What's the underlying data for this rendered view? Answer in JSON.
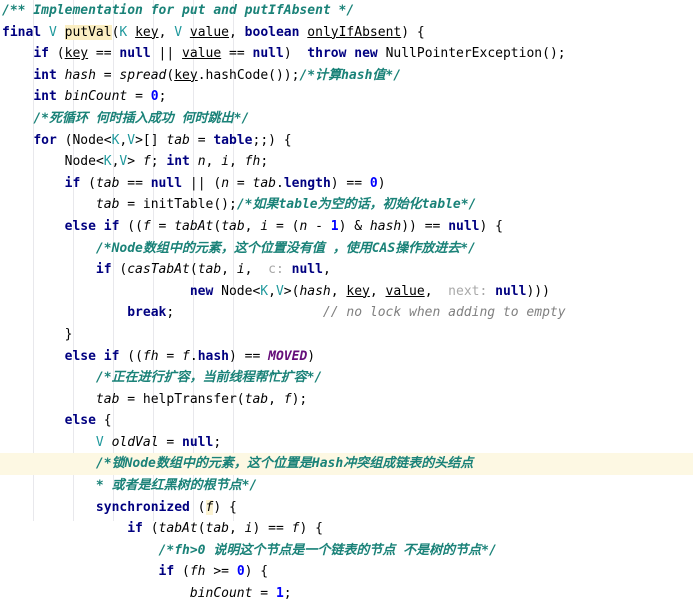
{
  "editor": {
    "language": "Java",
    "theme": "IntelliJ Light",
    "colors": {
      "background": "#ffffff",
      "keyword": "#000080",
      "comment": "#1a8278",
      "line_comment": "#808080",
      "type_param": "#20999d",
      "number": "#0000ff",
      "static_final_field": "#660e7a",
      "inlay_hint": "#a8a8a8",
      "caret_row": "#fdf8e3",
      "usage_highlight": "#fbeec2",
      "indent_guide": "#e8e8ec"
    },
    "caret_line_index": 21,
    "indent_guide_x": [
      33,
      73,
      113,
      153,
      193,
      233
    ]
  },
  "code_lines": [
    {
      "indent": 0,
      "tokens": [
        {
          "t": "/** Implementation for put and putIfAbsent */",
          "c": "cmt"
        }
      ]
    },
    {
      "indent": 0,
      "tokens": [
        {
          "t": "final",
          "c": "kw"
        },
        {
          "t": " ",
          "c": "plain"
        },
        {
          "t": "V",
          "c": "typ"
        },
        {
          "t": " ",
          "c": "plain"
        },
        {
          "t": "putVal",
          "c": "mth mark"
        },
        {
          "t": "(",
          "c": "plain"
        },
        {
          "t": "K",
          "c": "typ"
        },
        {
          "t": " ",
          "c": "plain"
        },
        {
          "t": "key",
          "c": "prm"
        },
        {
          "t": ", ",
          "c": "plain"
        },
        {
          "t": "V",
          "c": "typ"
        },
        {
          "t": " ",
          "c": "plain"
        },
        {
          "t": "value",
          "c": "prm"
        },
        {
          "t": ", ",
          "c": "plain"
        },
        {
          "t": "boolean",
          "c": "kw"
        },
        {
          "t": " ",
          "c": "plain"
        },
        {
          "t": "onlyIfAbsent",
          "c": "prm"
        },
        {
          "t": ") {",
          "c": "plain"
        }
      ]
    },
    {
      "indent": 1,
      "tokens": [
        {
          "t": "if",
          "c": "kw"
        },
        {
          "t": " (",
          "c": "plain"
        },
        {
          "t": "key",
          "c": "prm"
        },
        {
          "t": " == ",
          "c": "plain"
        },
        {
          "t": "null",
          "c": "kw"
        },
        {
          "t": " || ",
          "c": "plain"
        },
        {
          "t": "value",
          "c": "prm"
        },
        {
          "t": " == ",
          "c": "plain"
        },
        {
          "t": "null",
          "c": "kw"
        },
        {
          "t": ")  ",
          "c": "plain"
        },
        {
          "t": "throw",
          "c": "kw"
        },
        {
          "t": " ",
          "c": "plain"
        },
        {
          "t": "new",
          "c": "kw"
        },
        {
          "t": " ",
          "c": "plain"
        },
        {
          "t": "NullPointerException",
          "c": "cls"
        },
        {
          "t": "();",
          "c": "plain"
        }
      ]
    },
    {
      "indent": 1,
      "tokens": [
        {
          "t": "int",
          "c": "kw"
        },
        {
          "t": " ",
          "c": "plain"
        },
        {
          "t": "hash",
          "c": "loc"
        },
        {
          "t": " = ",
          "c": "plain"
        },
        {
          "t": "spread",
          "c": "loc"
        },
        {
          "t": "(",
          "c": "plain"
        },
        {
          "t": "key",
          "c": "prm"
        },
        {
          "t": ".hashCode());",
          "c": "plain"
        },
        {
          "t": "/*计算hash值*/",
          "c": "cmt"
        }
      ]
    },
    {
      "indent": 1,
      "tokens": [
        {
          "t": "int",
          "c": "kw"
        },
        {
          "t": " ",
          "c": "plain"
        },
        {
          "t": "binCount",
          "c": "loc"
        },
        {
          "t": " = ",
          "c": "plain"
        },
        {
          "t": "0",
          "c": "num"
        },
        {
          "t": ";",
          "c": "plain"
        }
      ]
    },
    {
      "indent": 1,
      "tokens": [
        {
          "t": "/*死循环 何时插入成功 何时跳出*/",
          "c": "cmt"
        }
      ]
    },
    {
      "indent": 1,
      "tokens": [
        {
          "t": "for",
          "c": "kw"
        },
        {
          "t": " (",
          "c": "plain"
        },
        {
          "t": "Node",
          "c": "cls"
        },
        {
          "t": "<",
          "c": "plain"
        },
        {
          "t": "K",
          "c": "typ"
        },
        {
          "t": ",",
          "c": "plain"
        },
        {
          "t": "V",
          "c": "typ"
        },
        {
          "t": ">[] ",
          "c": "plain"
        },
        {
          "t": "tab",
          "c": "loc"
        },
        {
          "t": " = ",
          "c": "plain"
        },
        {
          "t": "table",
          "c": "kw"
        },
        {
          "t": ";;) {",
          "c": "plain"
        }
      ]
    },
    {
      "indent": 2,
      "tokens": [
        {
          "t": "Node",
          "c": "cls"
        },
        {
          "t": "<",
          "c": "plain"
        },
        {
          "t": "K",
          "c": "typ"
        },
        {
          "t": ",",
          "c": "plain"
        },
        {
          "t": "V",
          "c": "typ"
        },
        {
          "t": "> ",
          "c": "plain"
        },
        {
          "t": "f",
          "c": "loc"
        },
        {
          "t": "; ",
          "c": "plain"
        },
        {
          "t": "int",
          "c": "kw"
        },
        {
          "t": " ",
          "c": "plain"
        },
        {
          "t": "n",
          "c": "loc"
        },
        {
          "t": ", ",
          "c": "plain"
        },
        {
          "t": "i",
          "c": "loc"
        },
        {
          "t": ", ",
          "c": "plain"
        },
        {
          "t": "fh",
          "c": "loc"
        },
        {
          "t": ";",
          "c": "plain"
        }
      ]
    },
    {
      "indent": 2,
      "tokens": [
        {
          "t": "if",
          "c": "kw"
        },
        {
          "t": " (",
          "c": "plain"
        },
        {
          "t": "tab",
          "c": "loc"
        },
        {
          "t": " == ",
          "c": "plain"
        },
        {
          "t": "null",
          "c": "kw"
        },
        {
          "t": " || (",
          "c": "plain"
        },
        {
          "t": "n",
          "c": "loc"
        },
        {
          "t": " = ",
          "c": "plain"
        },
        {
          "t": "tab",
          "c": "loc"
        },
        {
          "t": ".",
          "c": "plain"
        },
        {
          "t": "length",
          "c": "kw"
        },
        {
          "t": ") == ",
          "c": "plain"
        },
        {
          "t": "0",
          "c": "num"
        },
        {
          "t": ")",
          "c": "plain"
        }
      ]
    },
    {
      "indent": 3,
      "tokens": [
        {
          "t": "tab",
          "c": "loc"
        },
        {
          "t": " = initTable();",
          "c": "plain"
        },
        {
          "t": "/*如果table为空的话，初始化table*/",
          "c": "cmt"
        }
      ]
    },
    {
      "indent": 2,
      "tokens": [
        {
          "t": "else",
          "c": "kw"
        },
        {
          "t": " ",
          "c": "plain"
        },
        {
          "t": "if",
          "c": "kw"
        },
        {
          "t": " ((",
          "c": "plain"
        },
        {
          "t": "f",
          "c": "loc"
        },
        {
          "t": " = ",
          "c": "plain"
        },
        {
          "t": "tabAt",
          "c": "loc"
        },
        {
          "t": "(",
          "c": "plain"
        },
        {
          "t": "tab",
          "c": "loc"
        },
        {
          "t": ", ",
          "c": "plain"
        },
        {
          "t": "i",
          "c": "loc"
        },
        {
          "t": " = (",
          "c": "plain"
        },
        {
          "t": "n",
          "c": "loc"
        },
        {
          "t": " - ",
          "c": "plain"
        },
        {
          "t": "1",
          "c": "num"
        },
        {
          "t": ") & ",
          "c": "plain"
        },
        {
          "t": "hash",
          "c": "loc"
        },
        {
          "t": ")) == ",
          "c": "plain"
        },
        {
          "t": "null",
          "c": "kw"
        },
        {
          "t": ") {",
          "c": "plain"
        }
      ]
    },
    {
      "indent": 3,
      "tokens": [
        {
          "t": "/*Node数组中的元素，这个位置没有值 ，使用CAS操作放进去*/",
          "c": "cmt"
        }
      ]
    },
    {
      "indent": 3,
      "tokens": [
        {
          "t": "if",
          "c": "kw"
        },
        {
          "t": " (",
          "c": "plain"
        },
        {
          "t": "casTabAt",
          "c": "loc"
        },
        {
          "t": "(",
          "c": "plain"
        },
        {
          "t": "tab",
          "c": "loc"
        },
        {
          "t": ", ",
          "c": "plain"
        },
        {
          "t": "i",
          "c": "loc"
        },
        {
          "t": ",  ",
          "c": "plain"
        },
        {
          "t": "c:",
          "c": "hint"
        },
        {
          "t": " ",
          "c": "plain"
        },
        {
          "t": "null",
          "c": "kw"
        },
        {
          "t": ",",
          "c": "plain"
        }
      ]
    },
    {
      "indent": 6,
      "tokens": [
        {
          "t": "new",
          "c": "kw"
        },
        {
          "t": " ",
          "c": "plain"
        },
        {
          "t": "Node",
          "c": "cls"
        },
        {
          "t": "<",
          "c": "plain"
        },
        {
          "t": "K",
          "c": "typ"
        },
        {
          "t": ",",
          "c": "plain"
        },
        {
          "t": "V",
          "c": "typ"
        },
        {
          "t": ">(",
          "c": "plain"
        },
        {
          "t": "hash",
          "c": "loc"
        },
        {
          "t": ", ",
          "c": "plain"
        },
        {
          "t": "key",
          "c": "prm"
        },
        {
          "t": ", ",
          "c": "plain"
        },
        {
          "t": "value",
          "c": "prm"
        },
        {
          "t": ",  ",
          "c": "plain"
        },
        {
          "t": "next:",
          "c": "hint"
        },
        {
          "t": " ",
          "c": "plain"
        },
        {
          "t": "null",
          "c": "kw"
        },
        {
          "t": ")))",
          "c": "plain"
        }
      ]
    },
    {
      "indent": 4,
      "tokens": [
        {
          "t": "break",
          "c": "kw"
        },
        {
          "t": ";",
          "c": "plain"
        },
        {
          "t": "                   ",
          "c": "plain"
        },
        {
          "t": "// no lock when adding to empty",
          "c": "cmt2"
        }
      ]
    },
    {
      "indent": 2,
      "tokens": [
        {
          "t": "}",
          "c": "plain"
        }
      ]
    },
    {
      "indent": 2,
      "tokens": [
        {
          "t": "else",
          "c": "kw"
        },
        {
          "t": " ",
          "c": "plain"
        },
        {
          "t": "if",
          "c": "kw"
        },
        {
          "t": " ((",
          "c": "plain"
        },
        {
          "t": "fh",
          "c": "loc"
        },
        {
          "t": " = ",
          "c": "plain"
        },
        {
          "t": "f",
          "c": "loc"
        },
        {
          "t": ".",
          "c": "plain"
        },
        {
          "t": "hash",
          "c": "kw"
        },
        {
          "t": ") == ",
          "c": "plain"
        },
        {
          "t": "MOVED",
          "c": "fld"
        },
        {
          "t": ")",
          "c": "plain"
        }
      ]
    },
    {
      "indent": 3,
      "tokens": [
        {
          "t": "/*正在进行扩容，当前线程帮忙扩容*/",
          "c": "cmt"
        }
      ]
    },
    {
      "indent": 3,
      "tokens": [
        {
          "t": "tab",
          "c": "loc"
        },
        {
          "t": " = helpTransfer(",
          "c": "plain"
        },
        {
          "t": "tab",
          "c": "loc"
        },
        {
          "t": ", ",
          "c": "plain"
        },
        {
          "t": "f",
          "c": "loc"
        },
        {
          "t": ");",
          "c": "plain"
        }
      ]
    },
    {
      "indent": 2,
      "tokens": [
        {
          "t": "else",
          "c": "kw"
        },
        {
          "t": " {",
          "c": "plain"
        }
      ]
    },
    {
      "indent": 3,
      "tokens": [
        {
          "t": "V",
          "c": "typ"
        },
        {
          "t": " ",
          "c": "plain"
        },
        {
          "t": "oldVal",
          "c": "loc"
        },
        {
          "t": " = ",
          "c": "plain"
        },
        {
          "t": "null",
          "c": "kw"
        },
        {
          "t": ";",
          "c": "plain"
        }
      ]
    },
    {
      "indent": 3,
      "tokens": [
        {
          "t": "/*锁Node数组中的元素，这个位置是Hash冲突组成链表的头结点",
          "c": "cmt"
        }
      ]
    },
    {
      "indent": 3,
      "tokens": [
        {
          "t": "* 或者是红黑树的根节点*/",
          "c": "cmt"
        }
      ]
    },
    {
      "indent": 3,
      "tokens": [
        {
          "t": "synchronized",
          "c": "kw"
        },
        {
          "t": " (",
          "c": "plain"
        },
        {
          "t": "f",
          "c": "loc markf"
        },
        {
          "t": ") {",
          "c": "plain"
        }
      ]
    },
    {
      "indent": 4,
      "tokens": [
        {
          "t": "if",
          "c": "kw"
        },
        {
          "t": " (",
          "c": "plain"
        },
        {
          "t": "tabAt",
          "c": "loc"
        },
        {
          "t": "(",
          "c": "plain"
        },
        {
          "t": "tab",
          "c": "loc"
        },
        {
          "t": ", ",
          "c": "plain"
        },
        {
          "t": "i",
          "c": "loc"
        },
        {
          "t": ") == ",
          "c": "plain"
        },
        {
          "t": "f",
          "c": "loc"
        },
        {
          "t": ") {",
          "c": "plain"
        }
      ]
    },
    {
      "indent": 5,
      "tokens": [
        {
          "t": "/*fh>0 说明这个节点是一个链表的节点 不是树的节点*/",
          "c": "cmt"
        }
      ]
    },
    {
      "indent": 5,
      "tokens": [
        {
          "t": "if",
          "c": "kw"
        },
        {
          "t": " (",
          "c": "plain"
        },
        {
          "t": "fh",
          "c": "loc"
        },
        {
          "t": " >= ",
          "c": "plain"
        },
        {
          "t": "0",
          "c": "num"
        },
        {
          "t": ") {",
          "c": "plain"
        }
      ]
    },
    {
      "indent": 6,
      "tokens": [
        {
          "t": "binCount",
          "c": "loc"
        },
        {
          "t": " = ",
          "c": "plain"
        },
        {
          "t": "1",
          "c": "num"
        },
        {
          "t": ";",
          "c": "plain"
        }
      ]
    }
  ]
}
